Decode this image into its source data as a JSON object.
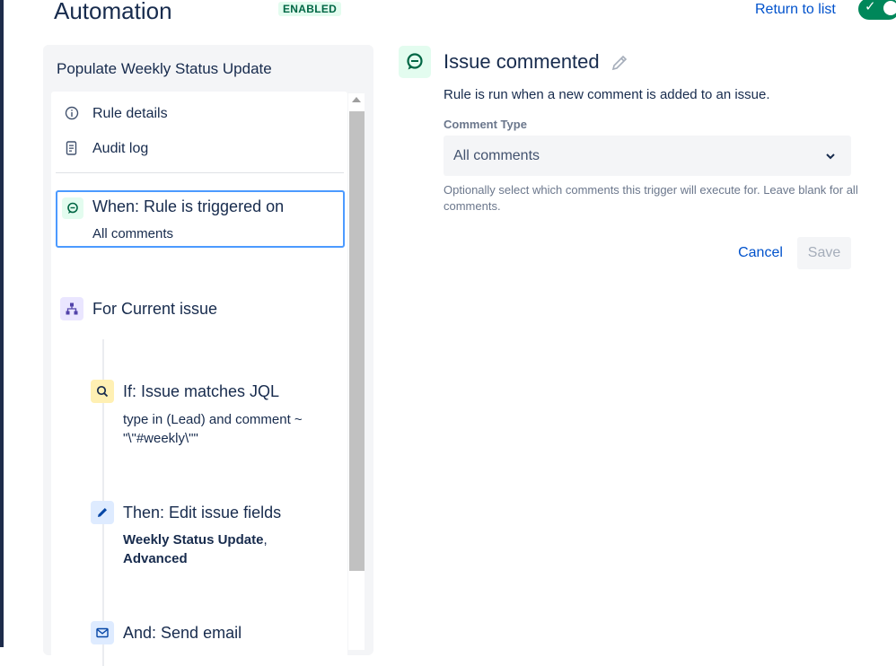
{
  "header": {
    "title": "Automation",
    "status_badge": "ENABLED",
    "return_link": "Return to list"
  },
  "rule": {
    "name": "Populate Weekly Status Update",
    "menu": [
      {
        "label": "Rule details",
        "icon": "info-icon"
      },
      {
        "label": "Audit log",
        "icon": "document-icon"
      }
    ],
    "trigger": {
      "title": "When: Rule is triggered on",
      "description": "All comments",
      "icon": "comment-icon"
    },
    "branch": {
      "title": "For Current issue",
      "icon": "hierarchy-icon"
    },
    "condition": {
      "title": "If: Issue matches JQL",
      "description": "type in (Lead) and comment ~ \"\\\"#weekly\\\"\"",
      "icon": "search-icon"
    },
    "action_edit": {
      "title": "Then: Edit issue fields",
      "field1": "Weekly Status Update",
      "sep": ",",
      "field2": "Advanced",
      "icon": "pencil-icon"
    },
    "action_email": {
      "title": "And: Send email",
      "icon": "mail-icon"
    }
  },
  "detail": {
    "title": "Issue commented",
    "description": "Rule is run when a new comment is added to an issue.",
    "field_label": "Comment Type",
    "field_value": "All comments",
    "helper_text": "Optionally select which comments this trigger will execute for. Leave blank for all comments.",
    "cancel_label": "Cancel",
    "save_label": "Save"
  },
  "colors": {
    "link": "#0052cc",
    "enabled_badge_bg": "#e3fcef",
    "enabled_badge_text": "#006644",
    "toggle_on": "#00875a",
    "selected_border": "#4c9aff"
  }
}
